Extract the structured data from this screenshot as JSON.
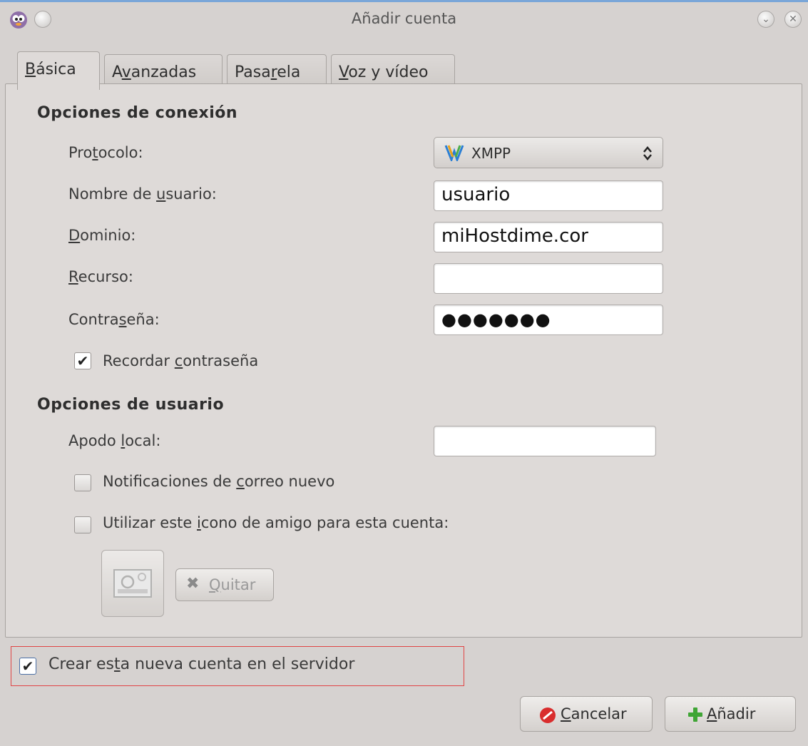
{
  "window": {
    "title": "Añadir cuenta",
    "controls": {
      "minimize_icon": "⌄",
      "close_icon": "✕"
    }
  },
  "tabs": [
    {
      "pre": "",
      "mn": "B",
      "post": "ásica",
      "active": true
    },
    {
      "pre": "A",
      "mn": "v",
      "post": "anzadas",
      "active": false
    },
    {
      "pre": "Pasa",
      "mn": "r",
      "post": "ela",
      "active": false
    },
    {
      "pre": "",
      "mn": "V",
      "post": "oz y vídeo",
      "active": false
    }
  ],
  "connection": {
    "heading": "Opciones de conexión",
    "protocol": {
      "pre": "Pro",
      "mn": "t",
      "post": "ocolo:",
      "value": "XMPP"
    },
    "username": {
      "pre": "Nombre de ",
      "mn": "u",
      "post": "suario:",
      "value": "usuario"
    },
    "domain": {
      "pre": "",
      "mn": "D",
      "post": "ominio:",
      "value": "miHostdime.cor"
    },
    "resource": {
      "pre": "",
      "mn": "R",
      "post": "ecurso:",
      "value": ""
    },
    "password": {
      "pre": "Contra",
      "mn": "s",
      "post": "eña:",
      "value": "●●●●●●●"
    },
    "remember": {
      "pre": "Recordar ",
      "mn": "c",
      "post": "ontraseña",
      "checked": "✔"
    }
  },
  "user_options": {
    "heading": "Opciones de usuario",
    "alias": {
      "pre": "Apodo ",
      "mn": "l",
      "post": "ocal:",
      "value": ""
    },
    "mail_notify": {
      "pre": "Notificaciones de ",
      "mn": "c",
      "post": "orreo nuevo"
    },
    "buddy_icon": {
      "pre": "Utilizar este ",
      "mn": "i",
      "post": "cono de amigo para esta cuenta:"
    },
    "remove_button": {
      "pre": "",
      "mn": "Q",
      "post": "uitar"
    }
  },
  "create_on_server": {
    "pre": "Crear es",
    "mn": "t",
    "post": "a nueva cuenta en el servidor",
    "checked": "✔"
  },
  "buttons": {
    "cancel": {
      "pre": "",
      "mn": "C",
      "post": "ancelar"
    },
    "add": {
      "pre": "",
      "mn": "A",
      "post": "ñadir"
    }
  },
  "colors": {
    "accent": "#7aa6d8",
    "highlight_box": "#e04545",
    "window_bg": "#d6d2d0"
  }
}
